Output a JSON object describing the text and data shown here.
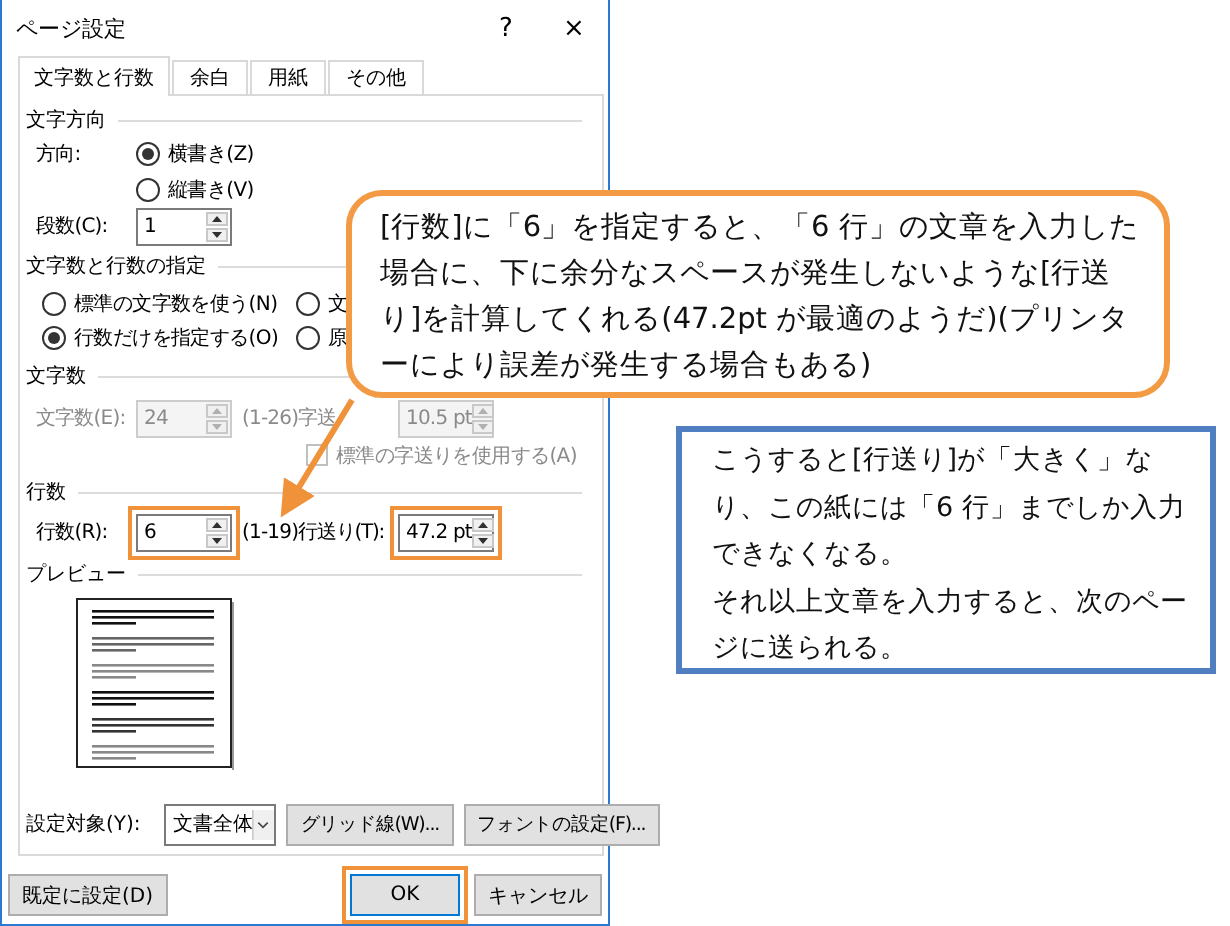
{
  "window": {
    "title": "ページ設定",
    "help": "?",
    "close": "×"
  },
  "tabs": [
    {
      "label": "文字数と行数",
      "selected": true
    },
    {
      "label": "余白",
      "selected": false
    },
    {
      "label": "用紙",
      "selected": false
    },
    {
      "label": "その他",
      "selected": false
    }
  ],
  "direction": {
    "heading": "文字方向",
    "label": "方向:",
    "options": [
      {
        "label": "横書き(Z)",
        "selected": true
      },
      {
        "label": "縦書き(V)",
        "selected": false
      }
    ],
    "columns_label": "段数(C):",
    "columns": {
      "value": "1",
      "disabled": false,
      "highlighted": false
    }
  },
  "grid_mode": {
    "heading": "文字数と行数の指定",
    "options": [
      {
        "label": "標準の文字数を使う(N)",
        "selected": false
      },
      {
        "label": "文",
        "selected": false
      },
      {
        "label": "行数だけを指定する(O)",
        "selected": true
      },
      {
        "label": "原",
        "selected": false
      }
    ]
  },
  "chars": {
    "heading": "文字数",
    "count_label": "文字数(E):",
    "count": {
      "value": "24",
      "disabled": true,
      "highlighted": false
    },
    "range": "(1-26)",
    "pitch_label": "字送",
    "pitch": {
      "value": "10.5 pt",
      "disabled": true,
      "highlighted": false
    },
    "default_pitch": {
      "label": "標準の字送りを使用する(A)",
      "checked": false,
      "disabled": true
    }
  },
  "lines": {
    "heading": "行数",
    "count_label": "行数(R):",
    "count": {
      "value": "6",
      "disabled": false,
      "highlighted": true
    },
    "range": "(1-19)",
    "pitch_label": "行送り(T):",
    "pitch": {
      "value": "47.2 pt",
      "disabled": false,
      "highlighted": true
    }
  },
  "preview": {
    "heading": "プレビュー"
  },
  "apply_to": {
    "label": "設定対象(Y):",
    "value": "文書全体"
  },
  "panel_buttons": [
    {
      "label": "グリッド線(W)...",
      "highlighted": false
    },
    {
      "label": "フォントの設定(F)...",
      "highlighted": false
    }
  ],
  "footer_buttons": [
    {
      "label": "既定に設定(D)",
      "highlighted": false
    },
    {
      "label": "OK",
      "highlighted": true
    },
    {
      "label": "キャンセル",
      "highlighted": false
    }
  ],
  "callouts": [
    {
      "kind": "speech",
      "paragraphs": [
        "[行数]に「6」を指定すると、「6 行」の文章を入力した場合に、下に余分なスペースが発生しないような[行送り]を計算してくれる(47.2pt が最適のようだ)(プリンターにより誤差が発生する場合もある)"
      ]
    },
    {
      "kind": "note",
      "paragraphs": [
        "こうすると[行送り]が「大きく」なり、この紙には「6 行」までしか入力できなくなる。",
        "それ以上文章を入力すると、次のページに送られる。"
      ]
    }
  ]
}
